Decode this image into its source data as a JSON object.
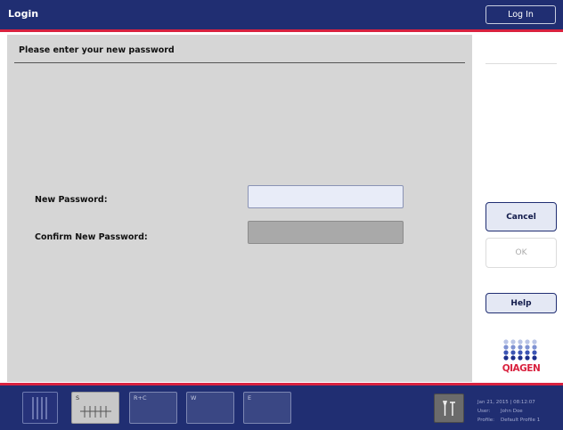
{
  "header": {
    "title": "Login",
    "login_button": "Log In"
  },
  "form": {
    "heading": "Please enter your new password",
    "new_password_label": "New Password:",
    "new_password_value": "",
    "confirm_password_label": "Confirm New Password:",
    "confirm_password_value": ""
  },
  "actions": {
    "cancel": "Cancel",
    "ok": "OK",
    "help": "Help"
  },
  "brand": {
    "logo_text": "QIAGEN"
  },
  "drawers": [
    {
      "label": ""
    },
    {
      "label": "S"
    },
    {
      "label": "R+C"
    },
    {
      "label": "W"
    },
    {
      "label": "E"
    }
  ],
  "status": {
    "datetime": "Jan 21, 2015 | 08:12:07",
    "user_key": "User:",
    "user_value": "John Doe",
    "profile_key": "Profile:",
    "profile_value": "Default Profile 1"
  },
  "icons": {
    "racks": "rack-slots-icon",
    "sample_tubes": "tube-rack-icon",
    "tools": "tools-icon"
  },
  "colors": {
    "bar": "#202e72",
    "accent": "#d9223f",
    "panel": "#d6d6d6"
  }
}
